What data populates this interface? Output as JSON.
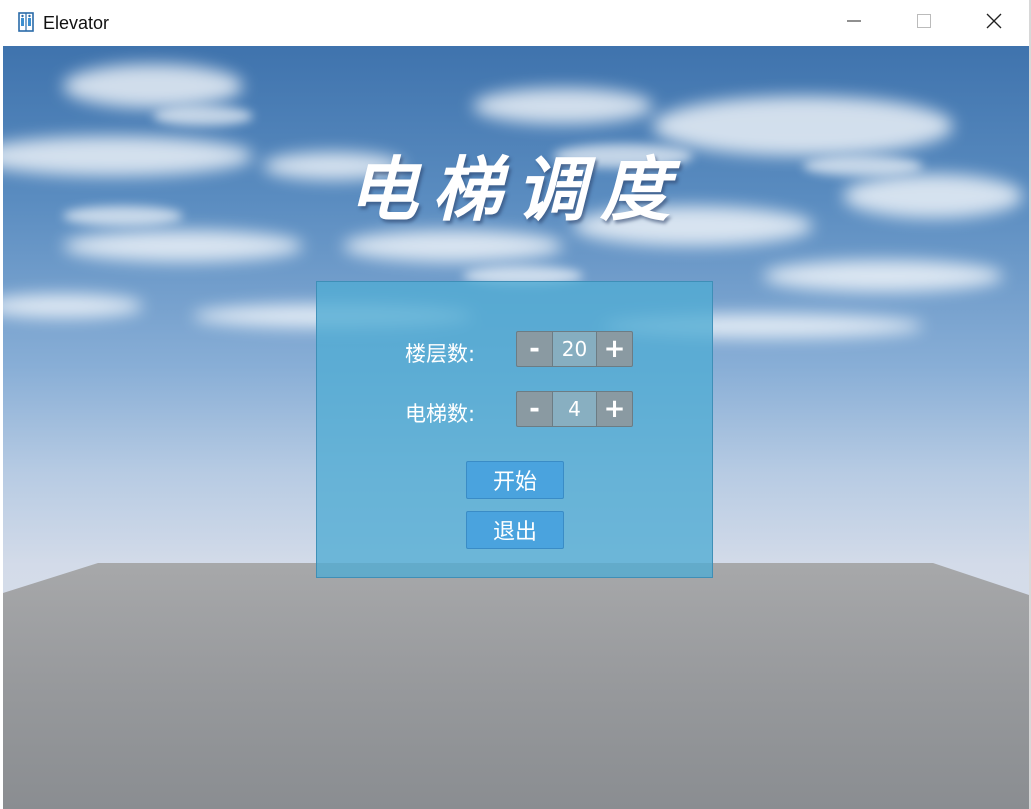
{
  "window": {
    "title": "Elevator",
    "controls": {
      "minimize": "minimize",
      "maximize": "maximize",
      "close": "close"
    }
  },
  "scene": {
    "heading": "电梯调度",
    "settings": {
      "floors": {
        "label": "楼层数:",
        "value": "20",
        "decrement": "-",
        "increment": "+"
      },
      "elevators": {
        "label": "电梯数:",
        "value": "4",
        "decrement": "-",
        "increment": "+"
      }
    },
    "buttons": {
      "start": "开始",
      "exit": "退出"
    }
  },
  "colors": {
    "panel": "#4facd4",
    "button": "#4aa3de",
    "stepper": "#8a9aa2",
    "sky_top": "#3f73ad",
    "ground": "#9a9c9f"
  },
  "icons": {
    "app": "elevator-icon",
    "minimize": "minimize-icon",
    "maximize": "maximize-icon",
    "close": "close-icon"
  }
}
